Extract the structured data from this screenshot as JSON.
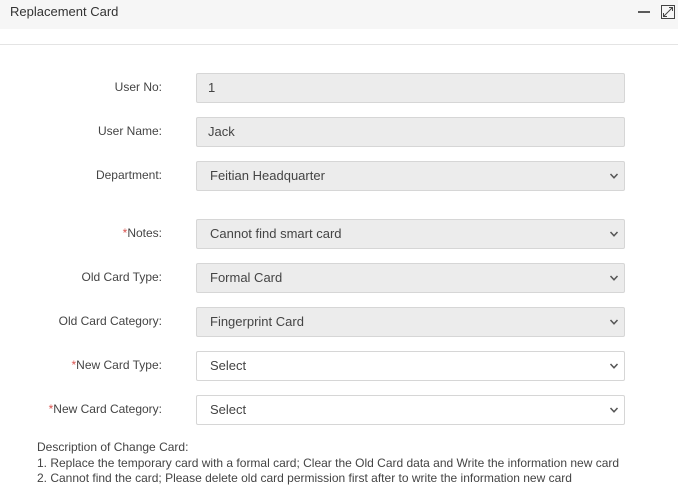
{
  "window": {
    "title": "Replacement Card"
  },
  "form": {
    "user_no": {
      "label": "User No:",
      "value": "1"
    },
    "user_name": {
      "label": "User Name:",
      "value": "Jack"
    },
    "department": {
      "label": "Department:",
      "value": "Feitian Headquarter"
    },
    "notes": {
      "required": "*",
      "label": "Notes:",
      "value": "Cannot find smart card"
    },
    "old_card_type": {
      "label": "Old Card Type:",
      "value": "Formal Card"
    },
    "old_card_category": {
      "label": "Old Card Category:",
      "value": "Fingerprint Card"
    },
    "new_card_type": {
      "required": "*",
      "label": "New Card Type:",
      "value": "Select"
    },
    "new_card_category": {
      "required": "*",
      "label": "New Card Category:",
      "value": "Select"
    }
  },
  "description": {
    "heading": "Description of Change Card:",
    "lines": [
      "1. Replace the temporary card with a formal card; Clear the Old Card data and Write the information new card",
      "2. Cannot find the card; Please delete old card permission first after to write the information new card"
    ]
  },
  "colors": {
    "required": "#d9534f",
    "disabled_field": "#ececec",
    "titlebar": "#f6f6f6"
  },
  "icons": {
    "minimize": "minimize-icon",
    "maximize": "maximize-icon",
    "dropdown": "chevron-down-icon"
  }
}
